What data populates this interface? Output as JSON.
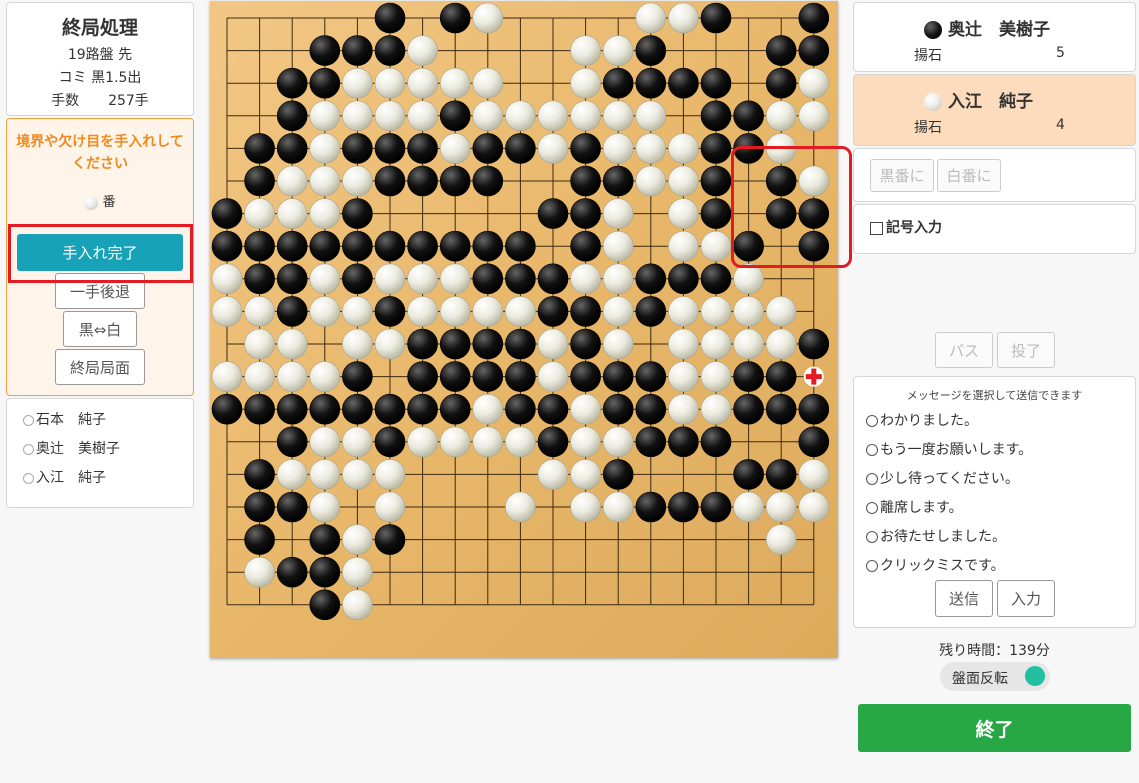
{
  "game_info": {
    "title": "終局処理",
    "board": "19路盤 先",
    "komi": "コミ 黒1.5出",
    "moves_label": "手数",
    "moves_value": "257手"
  },
  "instructions": {
    "text": "境界や欠け目を手入れしてください",
    "turn_label": "番",
    "done_button": "手入れ完了",
    "undo_button": "一手後退",
    "swap_button": "黒⇔白",
    "final_button": "終局局面"
  },
  "observers": [
    "石本　純子",
    "奥辻　美樹子",
    "入江　純子"
  ],
  "players": {
    "black": {
      "name": "奥辻　美樹子",
      "captured_label": "揚石",
      "captured": "5"
    },
    "white": {
      "name": "入江　純子",
      "captured_label": "揚石",
      "captured": "4"
    }
  },
  "turn_buttons": {
    "black": "黒番に",
    "white": "白番に"
  },
  "symbol_input": "記号入力",
  "action_buttons": {
    "pass": "パス",
    "resign": "投了"
  },
  "messages": {
    "header": "メッセージを選択して送信できます",
    "items": [
      "わかりました。",
      "もう一度お願いします。",
      "少し待ってください。",
      "離席します。",
      "お待たせしました。",
      "クリックミスです。"
    ],
    "send_button": "送信",
    "input_button": "入力"
  },
  "time_remaining": "残り時間：139分",
  "board_flip_label": "盤面反転",
  "end_button": "終了",
  "colors": {
    "accent_orange": "#f08a1c",
    "teal": "#17a2b8",
    "green": "#28a745",
    "highlight_red": "#e31b23",
    "white_player_bg": "#fcdcbd",
    "board": "#e8b76a"
  },
  "board": {
    "size": 19,
    "rows": [
      ".....B.BW....WWB..BW",
      "...BBBW....WWB...BBW",
      "..BBWWWWW..WBBBB.BW.",
      "..BWWWWBWWWWWW.BBWW.",
      ".BBWBBBWBBWBWWWBBW.",
      ".BWWWBBBB..BBWWB.BW.",
      "BWWWB.....BBW.WB.BB.",
      "BBBBBBBBBB.BW.WWB.B.",
      "WBBWBWWWBBBWWBBBW..",
      "WWBWWBWWWWBBWBWWWW",
      ".WW.WWBBBBWBW.WWWWB",
      "WWWWB.BBBBWBBBWWBB",
      "BBBBBBBBWBBWBBWWBBB",
      "..BWWBWWWWBWWBBB..B",
      ".BWWWW....WWB...BBW",
      ".BBW.W...W.WWBBBWWW",
      ".B.BWB...........W.",
      ".WBBW..............",
      "...BW..............."
    ]
  }
}
